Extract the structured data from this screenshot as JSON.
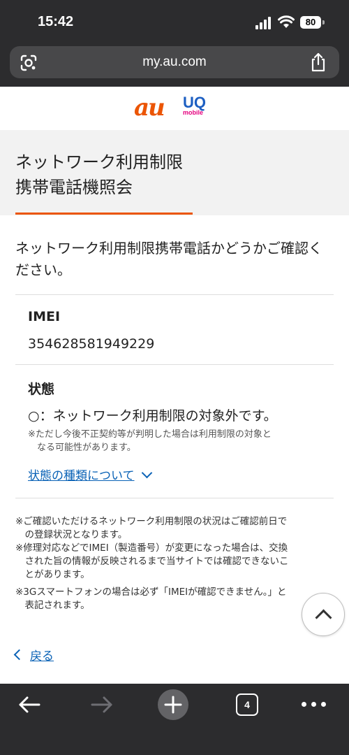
{
  "status": {
    "time": "15:42",
    "battery": "80"
  },
  "browser": {
    "url": "my.au.com",
    "tab_count": "4"
  },
  "logos": {
    "au": "au",
    "uq_main": "UQ",
    "uq_sub": "mobile"
  },
  "page": {
    "title_line1": "ネットワーク利用制限",
    "title_line2": "携帯電話機照会",
    "intro_line1": "ネットワーク利用制限携帯電話かどうかご確認く",
    "intro_line2": "ださい。",
    "imei_label": "IMEI",
    "imei_value": "354628581949229",
    "status_label": "状態",
    "status_value": "○：ネットワーク利用制限の対象外です。",
    "status_note_line1": "※ただし今後不正契約等が判明した場合は利用制限の対象と",
    "status_note_line2": "なる可能性があります。",
    "status_types_link": "状態の種類について",
    "footnotes": [
      "※ご確認いただけるネットワーク利用制限の状況はご確認前日で",
      "　の登録状況となります。",
      "※修理対応などでIMEI（製造番号）が変更になった場合は、交換",
      "　された旨の情報が反映されるまで当サイトでは確認できないこ",
      "　とがあります。",
      "※3Gスマートフォンの場合は必ず「IMEIが確認できません。」と",
      "　表記されます。"
    ],
    "back_link": "戻る"
  },
  "colors": {
    "accent": "#eb5505",
    "link": "#0a62b6",
    "chrome": "#2c2c2e"
  },
  "icons": [
    "google-lens-icon",
    "share-icon",
    "chevron-down-icon",
    "chevron-up-icon",
    "chevron-left-icon",
    "back-arrow-icon",
    "forward-arrow-icon",
    "plus-icon",
    "tabs-icon",
    "more-icon"
  ]
}
